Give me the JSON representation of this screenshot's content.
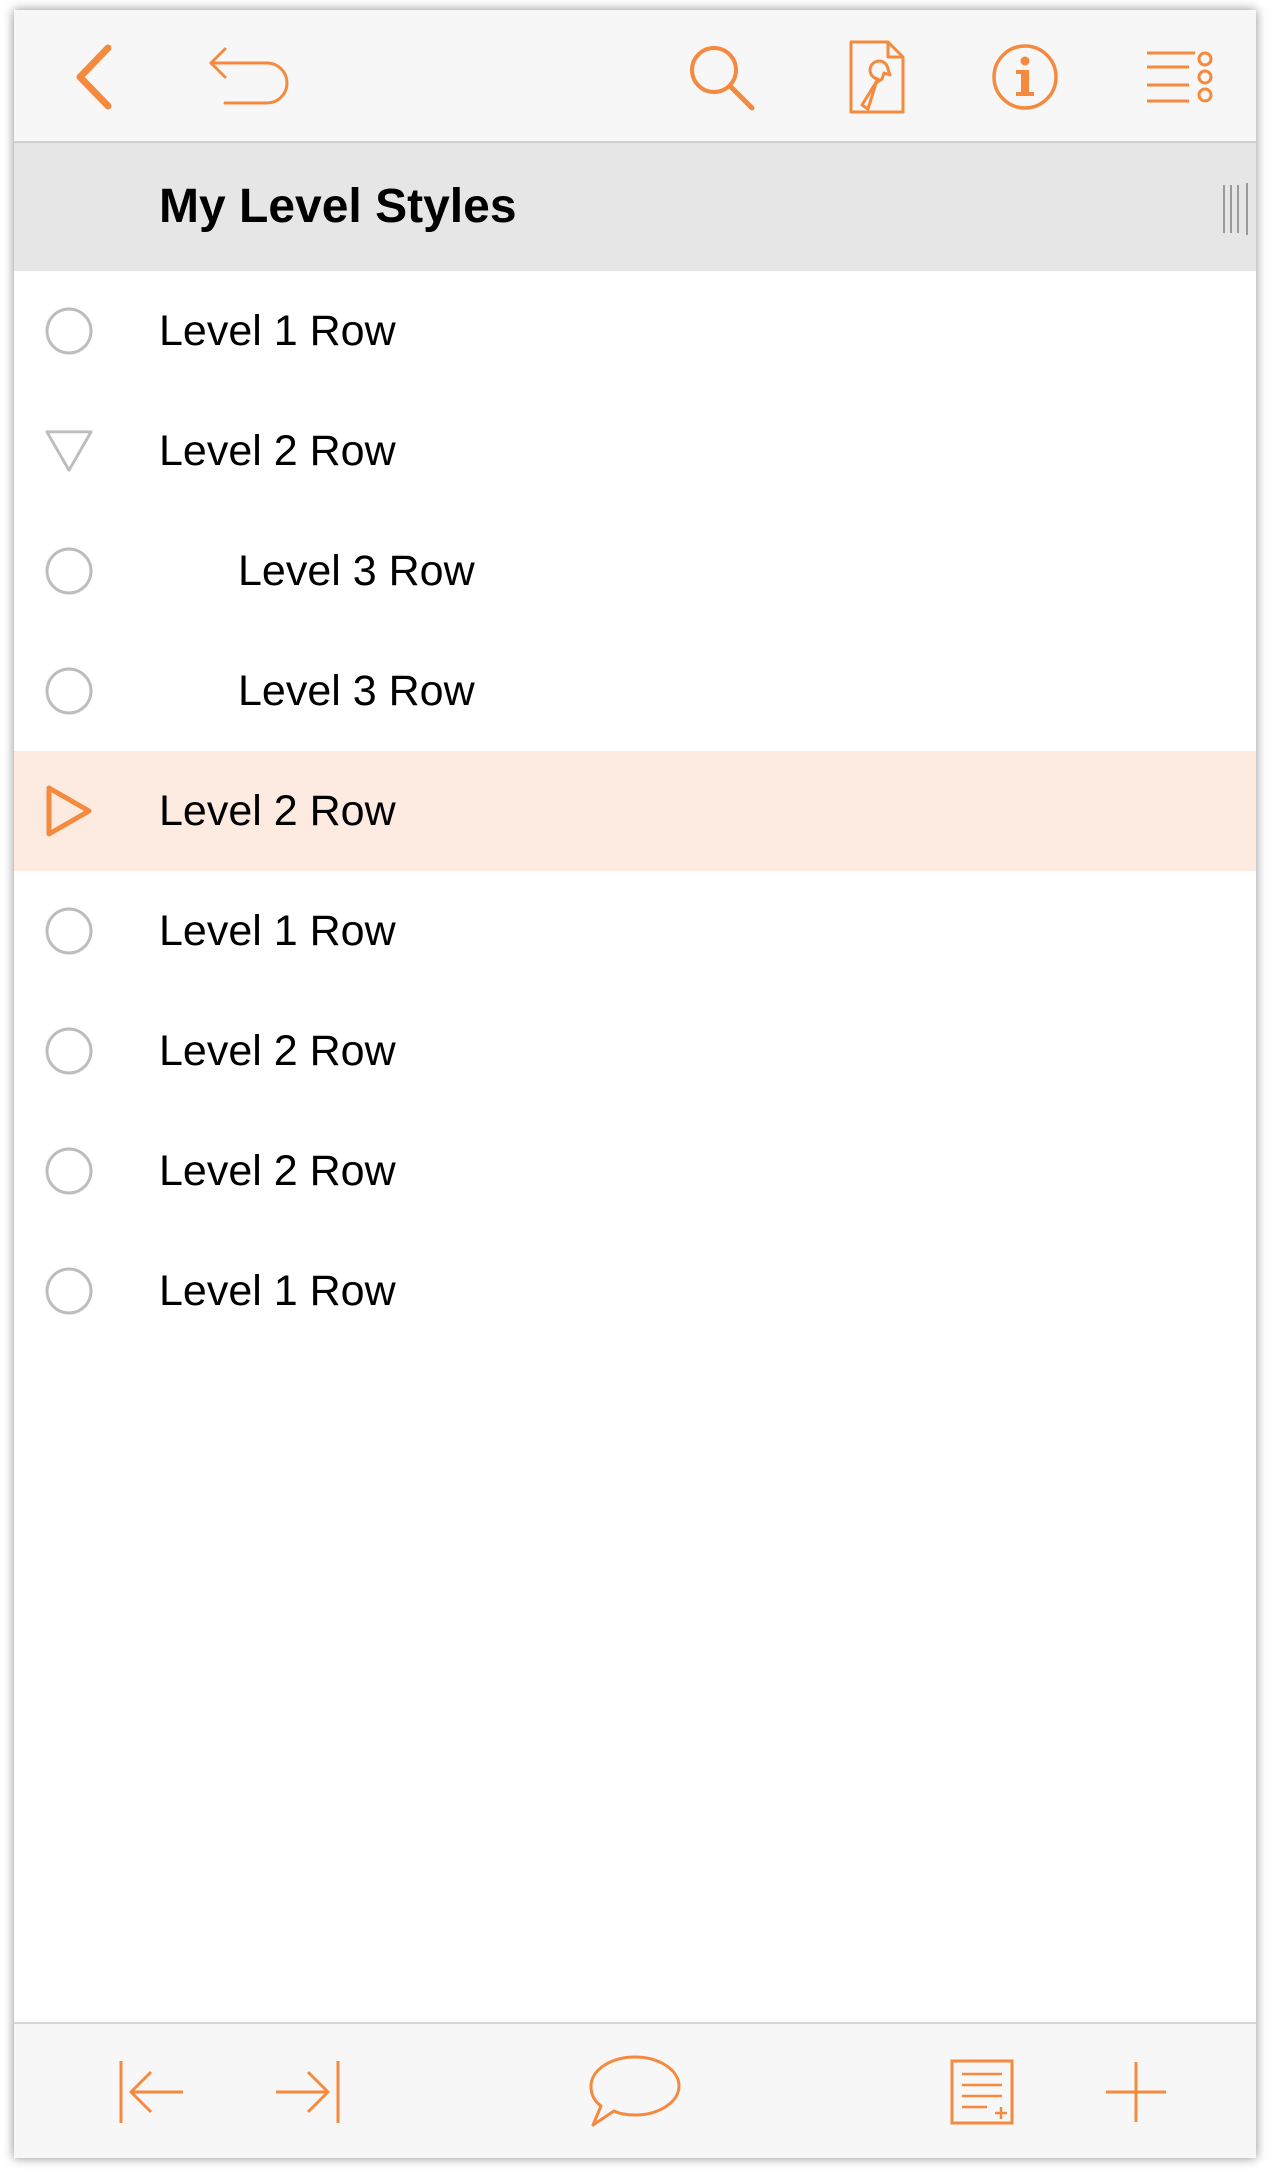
{
  "theme": {
    "accent": "#f58a3f",
    "row_selected_bg": "#fdeae0",
    "header_bg": "#e6e6e6",
    "toolbar_bg": "#f7f7f7"
  },
  "toolbar": {
    "left_icons": [
      "back-chevron-icon",
      "undo-icon"
    ],
    "right_icons": [
      "search-icon",
      "document-settings-icon",
      "info-icon",
      "outline-menu-icon"
    ]
  },
  "outline": {
    "title": "My Level Styles",
    "rows": [
      {
        "label": "Level 1 Row",
        "level": 1,
        "handle": "circle",
        "selected": false
      },
      {
        "label": "Level 2 Row",
        "level": 1,
        "handle": "triangle-down",
        "selected": false
      },
      {
        "label": "Level 3 Row",
        "level": 2,
        "handle": "circle",
        "selected": false
      },
      {
        "label": "Level 3 Row",
        "level": 2,
        "handle": "circle",
        "selected": false
      },
      {
        "label": "Level 2 Row",
        "level": 1,
        "handle": "triangle-right",
        "selected": true
      },
      {
        "label": "Level 1 Row",
        "level": 1,
        "handle": "circle",
        "selected": false
      },
      {
        "label": "Level 2 Row",
        "level": 1,
        "handle": "circle",
        "selected": false
      },
      {
        "label": "Level 2 Row",
        "level": 1,
        "handle": "circle",
        "selected": false
      },
      {
        "label": "Level 1 Row",
        "level": 1,
        "handle": "circle",
        "selected": false
      }
    ]
  },
  "bottombar": {
    "icons": [
      "outdent-icon",
      "indent-icon",
      "comment-icon",
      "add-note-icon",
      "add-row-icon"
    ]
  }
}
